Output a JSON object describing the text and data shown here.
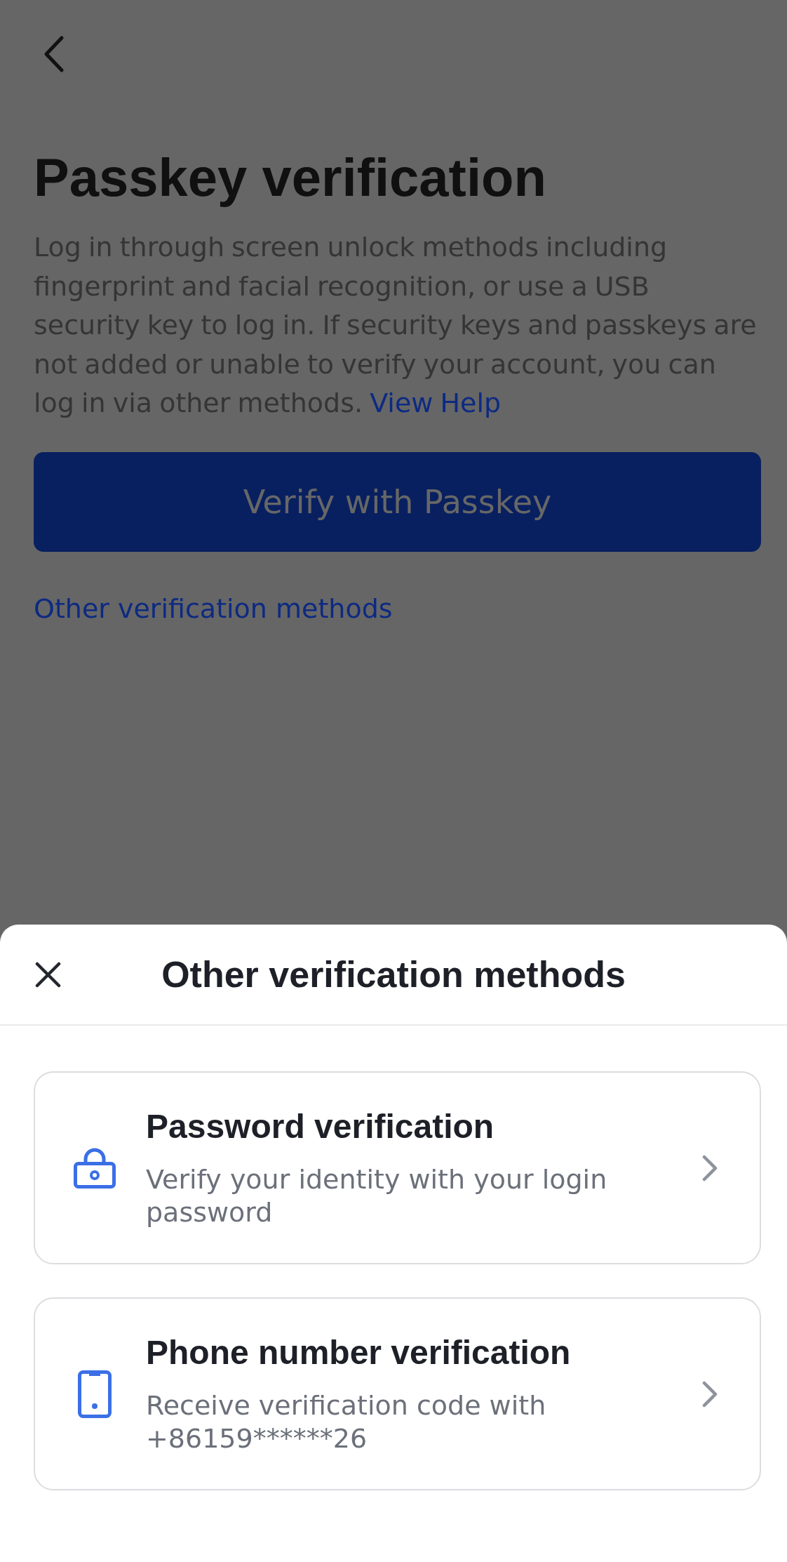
{
  "page": {
    "title": "Passkey verification",
    "description": "Log in through screen unlock methods including fingerprint and facial recognition, or use a USB security key to log in. If security keys and passkeys are not added or unable to verify your account, you can log in via other methods.",
    "help_link": "View Help",
    "verify_button": "Verify with Passkey",
    "other_methods_link": "Other verification methods"
  },
  "sheet": {
    "title": "Other verification methods",
    "methods": [
      {
        "kind": "password",
        "title": "Password verification",
        "description": "Verify your identity with your login password"
      },
      {
        "kind": "phone",
        "title": "Phone number verification",
        "description": "Receive verification code with +86159******26"
      }
    ]
  }
}
